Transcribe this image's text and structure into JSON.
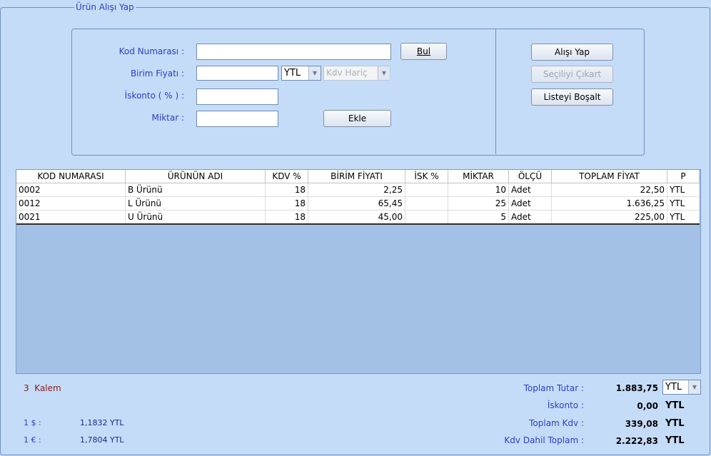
{
  "form": {
    "group_title": "Ürün Alışı Yap",
    "kod_label": "Kod Numarası  :",
    "birim_label": "Birim Fiyatı  :",
    "iskonto_label": "İskonto ( % ) :",
    "miktar_label": "Miktar  :",
    "kod_value": "",
    "birim_value": "",
    "iskonto_value": "",
    "miktar_value": "",
    "currency_selected": "YTL",
    "kdv_selected": "Kdv Hariç",
    "bul_label": "Bul",
    "ekle_label": "Ekle"
  },
  "actions": {
    "alis_yap": "Alışı Yap",
    "secili_cikart": "Seçiliyi Çıkart",
    "listeyi_bosalt": "Listeyi Boşalt"
  },
  "grid": {
    "columns": [
      "KOD NUMARASI",
      "ÜRÜNÜN ADI",
      "KDV %",
      "BİRİM FİYATI",
      "İSK %",
      "MİKTAR",
      "ÖLÇÜ",
      "TOPLAM FİYAT",
      "P"
    ],
    "rows": [
      [
        "0002",
        "B Ürünü",
        "18",
        "2,25",
        "",
        "10",
        "Adet",
        "22,50",
        "YTL"
      ],
      [
        "0012",
        "L Ürünü",
        "18",
        "65,45",
        "",
        "25",
        "Adet",
        "1.636,25",
        "YTL"
      ],
      [
        "0021",
        "U Ürünü",
        "18",
        "45,00",
        "",
        "5",
        "Adet",
        "225,00",
        "YTL"
      ]
    ]
  },
  "footer": {
    "kalem_count": "3",
    "kalem_label": "Kalem",
    "usd_label": "1 $  :",
    "usd_rate": "1,1832 YTL",
    "eur_label": "1 € :",
    "eur_rate": "1,7804 YTL",
    "toplam_tutar_label": "Toplam Tutar  :",
    "toplam_tutar_value": "1.883,75",
    "toplam_currency": "YTL",
    "iskonto_label": "İskonto  :",
    "iskonto_value": "0,00",
    "iskonto_currency": "YTL",
    "toplam_kdv_label": "Toplam Kdv  :",
    "toplam_kdv_value": "339,08",
    "toplam_kdv_currency": "YTL",
    "kdv_dahil_label": "Kdv Dahil Toplam  :",
    "kdv_dahil_value": "2.222,83",
    "kdv_dahil_currency": "YTL"
  }
}
